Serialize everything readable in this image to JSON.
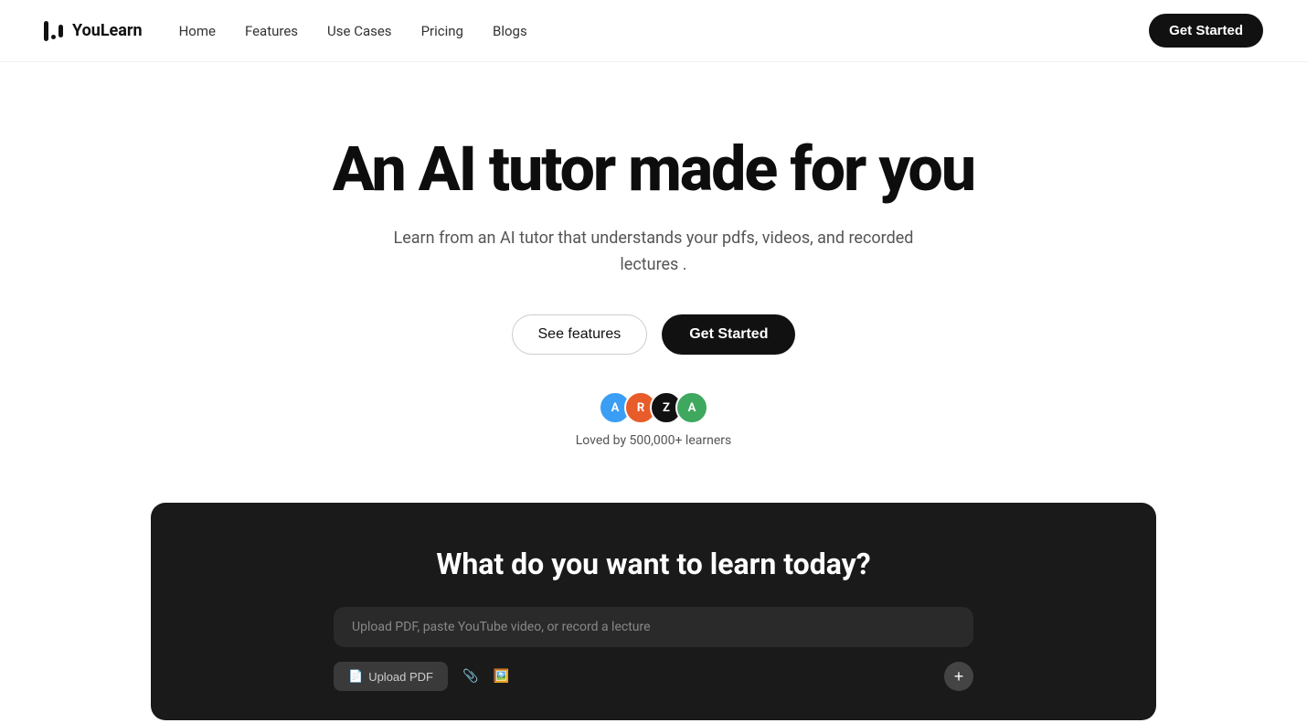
{
  "brand": {
    "name": "YouLearn"
  },
  "nav": {
    "links": [
      {
        "label": "Home",
        "id": "home"
      },
      {
        "label": "Features",
        "id": "features"
      },
      {
        "label": "Use Cases",
        "id": "use-cases"
      },
      {
        "label": "Pricing",
        "id": "pricing"
      },
      {
        "label": "Blogs",
        "id": "blogs"
      }
    ],
    "cta_label": "Get Started"
  },
  "hero": {
    "title": "An AI tutor made for you",
    "subtitle": "Learn from an AI tutor that understands your pdfs, videos, and recorded lectures .",
    "see_features_label": "See features",
    "get_started_label": "Get Started"
  },
  "social_proof": {
    "avatars": [
      {
        "letter": "A",
        "color": "#3b9ef5"
      },
      {
        "letter": "R",
        "color": "#e85c2a"
      },
      {
        "letter": "Z",
        "color": "#111111"
      },
      {
        "letter": "A",
        "color": "#3fa85f"
      }
    ],
    "text": "Loved by 500,000+ learners"
  },
  "demo": {
    "title": "What do you want to learn today?",
    "input_placeholder": "Upload PDF, paste YouTube video, or record a lecture",
    "upload_btn_label": "Upload PDF",
    "add_btn_label": "+"
  }
}
